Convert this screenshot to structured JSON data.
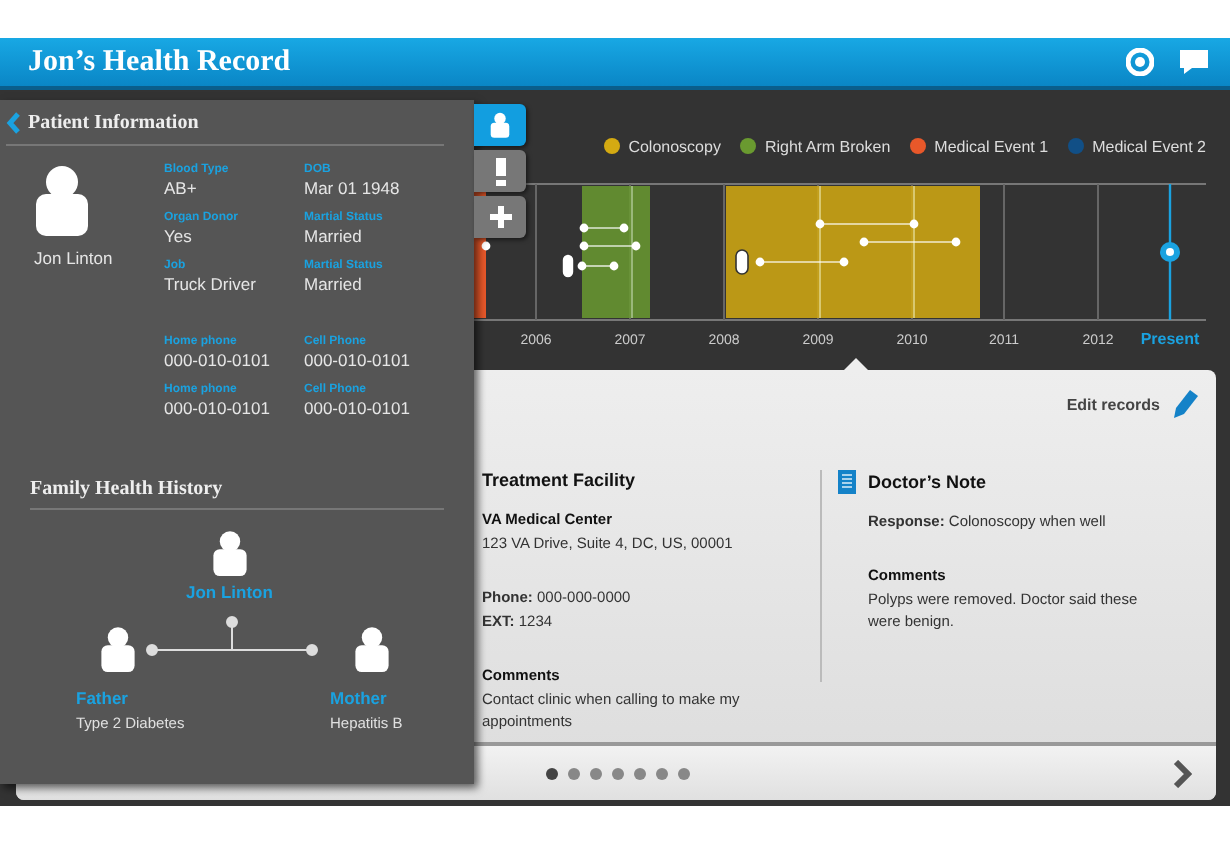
{
  "header": {
    "title": "Jon’s Health Record"
  },
  "legend": [
    {
      "label": "Colonoscopy",
      "color": "#d4aa12"
    },
    {
      "label": "Right Arm Broken",
      "color": "#6a9a30"
    },
    {
      "label": "Medical Event 1",
      "color": "#e8582a"
    },
    {
      "label": "Medical Event 2",
      "color": "#114f86"
    }
  ],
  "timeline": {
    "years": [
      {
        "label": "2006",
        "selected": false
      },
      {
        "label": "2007",
        "selected": false
      },
      {
        "label": "2008",
        "selected": false
      },
      {
        "label": "2009",
        "selected": false
      },
      {
        "label": "2010",
        "selected": false
      },
      {
        "label": "2011",
        "selected": false
      },
      {
        "label": "2012",
        "selected": false
      },
      {
        "label": "Present",
        "selected": true
      }
    ]
  },
  "panel": {
    "title": "Patient Information",
    "name": "Jon Linton",
    "tabs": [
      {
        "kind": "person",
        "selected": true
      },
      {
        "kind": "alert",
        "selected": false
      },
      {
        "kind": "add",
        "selected": false
      }
    ],
    "fields": [
      {
        "label": "Blood Type",
        "value": "AB+"
      },
      {
        "label": "DOB",
        "value": "Mar 01 1948"
      },
      {
        "label": "Organ Donor",
        "value": "Yes"
      },
      {
        "label": "Martial Status",
        "value": "Married"
      },
      {
        "label": "Job",
        "value": "Truck Driver"
      },
      {
        "label": "Martial Status",
        "value": "Married"
      },
      {
        "label": "Home phone",
        "value": "000-010-0101"
      },
      {
        "label": "Cell Phone",
        "value": "000-010-0101"
      },
      {
        "label": "Home phone",
        "value": "000-010-0101"
      },
      {
        "label": "Cell Phone",
        "value": "000-010-0101"
      }
    ]
  },
  "family": {
    "title": "Family Health History",
    "self": {
      "name": "Jon Linton"
    },
    "parents": [
      {
        "relation": "Father",
        "condition": "Type 2 Diabetes"
      },
      {
        "relation": "Mother",
        "condition": "Hepatitis B"
      }
    ]
  },
  "record": {
    "edit_label": "Edit records",
    "facility": {
      "heading": "Treatment Facility",
      "name": "VA Medical Center",
      "address": "123 VA Drive, Suite 4, DC, US, 00001",
      "phone": "**Phone:** 000-000-0000",
      "ext": "**EXT:** 1234",
      "comments_label": "Comments",
      "comments": "Contact clinic when calling to make my appointments"
    },
    "note": {
      "heading": "Doctor’s Note",
      "response": "**Response:** Colonoscopy when well",
      "comments_label": "Comments",
      "comments": "Polyps were removed. Doctor said these were benign."
    },
    "pages": [
      {
        "selected": true
      },
      {
        "selected": false
      },
      {
        "selected": false
      },
      {
        "selected": false
      },
      {
        "selected": false
      },
      {
        "selected": false
      },
      {
        "selected": false
      }
    ]
  }
}
